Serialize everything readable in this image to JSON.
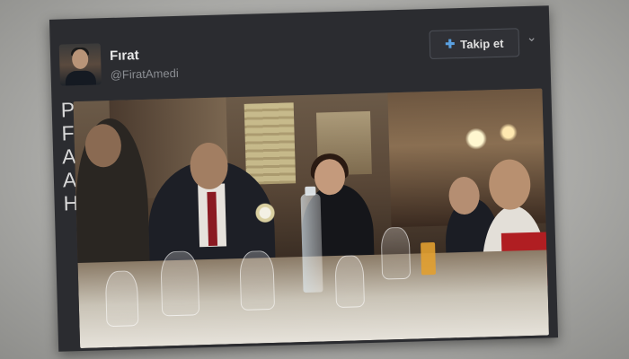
{
  "tweet": {
    "author_name": "Fırat",
    "author_handle": "@FiratAmedi",
    "follow_label": "Takip et",
    "text_lines": [
      "Pkk yöneticisi Remzi Kartal",
      "F",
      "A",
      "A",
      "H"
    ]
  },
  "icons": {
    "follow": "add-user-icon",
    "menu": "chevron-down-icon"
  },
  "colors": {
    "card_background": "#2b2c30",
    "page_background": "#b0b0ad",
    "follow_icon": "#5aa0e0",
    "vest": "#b01e22"
  }
}
